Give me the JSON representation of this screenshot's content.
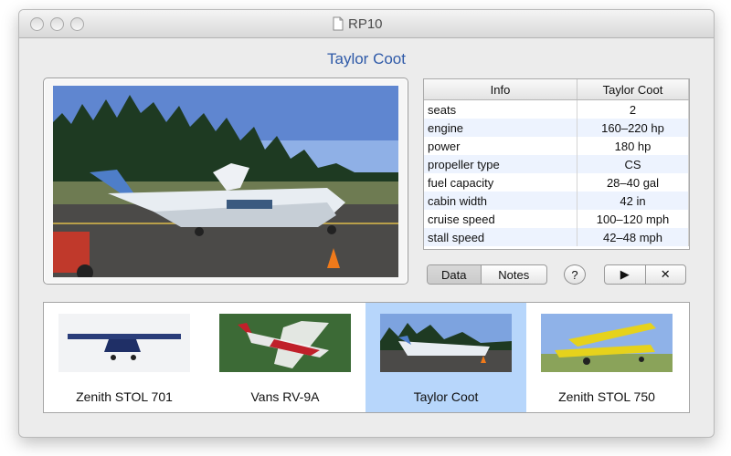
{
  "window": {
    "title": "RP10"
  },
  "page": {
    "title": "Taylor Coot"
  },
  "info_table": {
    "headers": [
      "Info",
      "Taylor Coot"
    ],
    "rows": [
      [
        "seats",
        "2"
      ],
      [
        "engine",
        "160–220 hp"
      ],
      [
        "power",
        "180 hp"
      ],
      [
        "propeller type",
        "CS"
      ],
      [
        "fuel capacity",
        "28–40 gal"
      ],
      [
        "cabin width",
        "42 in"
      ],
      [
        "cruise speed",
        "100–120 mph"
      ],
      [
        "stall speed",
        "42–48 mph"
      ]
    ]
  },
  "buttons": {
    "data": "Data",
    "notes": "Notes",
    "help": "?",
    "play": "▶",
    "close": "✕"
  },
  "thumbnails": [
    {
      "label": "Zenith STOL 701",
      "selected": false
    },
    {
      "label": "Vans RV-9A",
      "selected": false
    },
    {
      "label": "Taylor Coot",
      "selected": true
    },
    {
      "label": "Zenith STOL 750",
      "selected": false
    }
  ],
  "colors": {
    "accent_title": "#2f5aa8",
    "selection": "#b7d6fb"
  }
}
